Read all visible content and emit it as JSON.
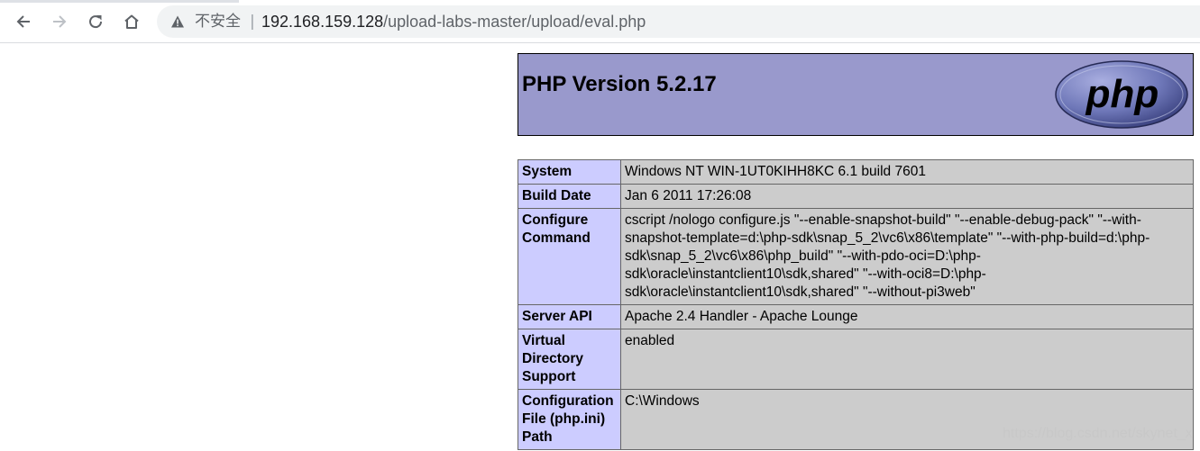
{
  "browser": {
    "security_label": "不安全",
    "separator": "|",
    "url_host": "192.168.159.128",
    "url_path": "/upload-labs-master/upload/eval.php",
    "icons": [
      "back-arrow-icon",
      "forward-arrow-icon",
      "reload-icon",
      "home-icon",
      "warning-icon"
    ]
  },
  "php": {
    "title": "PHP Version 5.2.17",
    "logo_text": "php",
    "rows": [
      {
        "key": "System",
        "value": "Windows NT WIN-1UT0KIHH8KC 6.1 build 7601"
      },
      {
        "key": "Build Date",
        "value": "Jan 6 2011 17:26:08"
      },
      {
        "key": "Configure Command",
        "value": "cscript /nologo configure.js \"--enable-snapshot-build\" \"--enable-debug-pack\" \"--with-snapshot-template=d:\\php-sdk\\snap_5_2\\vc6\\x86\\template\" \"--with-php-build=d:\\php-sdk\\snap_5_2\\vc6\\x86\\php_build\" \"--with-pdo-oci=D:\\php-sdk\\oracle\\instantclient10\\sdk,shared\" \"--with-oci8=D:\\php-sdk\\oracle\\instantclient10\\sdk,shared\" \"--without-pi3web\""
      },
      {
        "key": "Server API",
        "value": "Apache 2.4 Handler - Apache Lounge"
      },
      {
        "key": "Virtual Directory Support",
        "value": "enabled"
      },
      {
        "key": "Configuration File (php.ini) Path",
        "value": "C:\\Windows"
      }
    ]
  },
  "watermark": "https://blog.csdn.net/skynet_x",
  "colors": {
    "header_bg": "#9999cc",
    "key_bg": "#ccccff",
    "value_bg": "#cccccc"
  }
}
